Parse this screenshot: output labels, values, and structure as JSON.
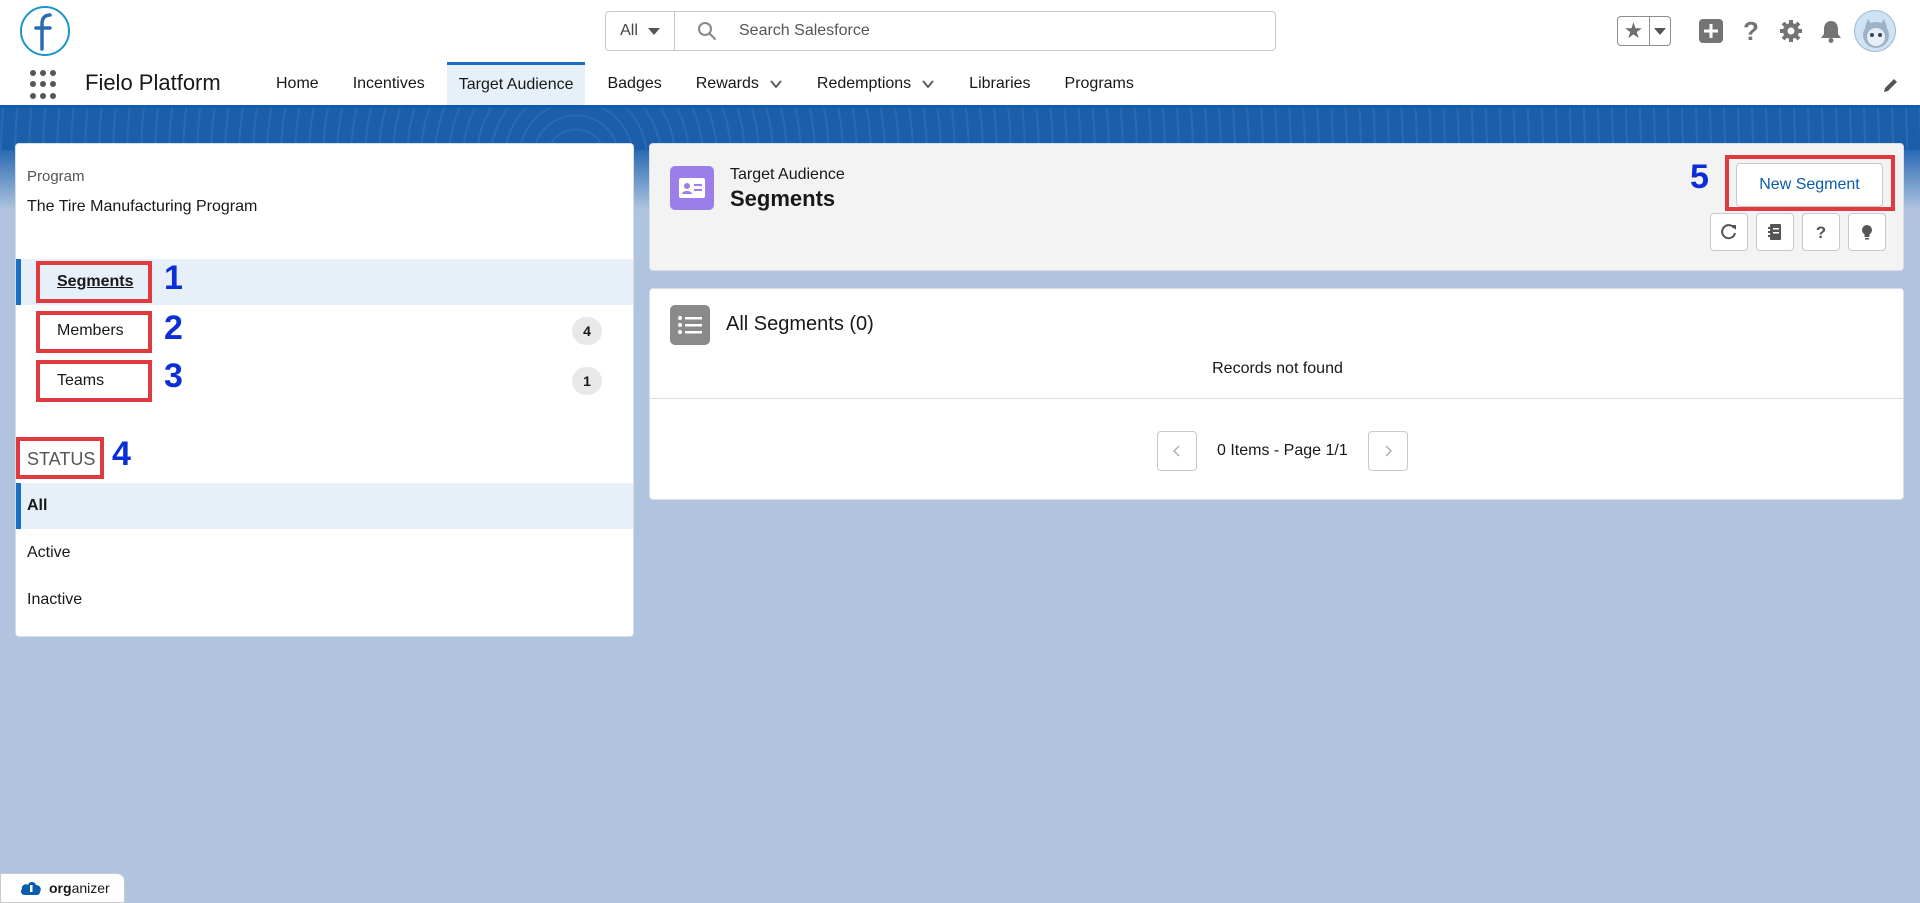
{
  "header": {
    "search_scope": "All",
    "search_placeholder": "Search Salesforce",
    "icons": [
      "logo-f-icon",
      "search-icon",
      "favorites-star-icon",
      "add-icon",
      "help-icon",
      "settings-gear-icon",
      "notifications-bell-icon",
      "avatar"
    ]
  },
  "nav": {
    "app_name": "Fielo Platform",
    "tabs": [
      {
        "label": "Home"
      },
      {
        "label": "Incentives"
      },
      {
        "label": "Target Audience",
        "active": true
      },
      {
        "label": "Badges"
      },
      {
        "label": "Rewards",
        "dropdown": true
      },
      {
        "label": "Redemptions",
        "dropdown": true
      },
      {
        "label": "Libraries"
      },
      {
        "label": "Programs"
      }
    ]
  },
  "left_panel": {
    "program_label": "Program",
    "program_name": "The Tire Manufacturing Program",
    "items": [
      {
        "label": "Segments",
        "selected": true
      },
      {
        "label": "Members",
        "count": "4"
      },
      {
        "label": "Teams",
        "count": "1"
      }
    ],
    "status_heading": "STATUS",
    "status_items": [
      {
        "label": "All",
        "selected": true
      },
      {
        "label": "Active"
      },
      {
        "label": "Inactive"
      }
    ]
  },
  "header_card": {
    "subtitle": "Target Audience",
    "title": "Segments",
    "new_button": "New Segment"
  },
  "list_card": {
    "title": "All Segments (0)",
    "empty_text": "Records not found",
    "pager_text": "0 Items - Page 1/1"
  },
  "annotations": [
    "1",
    "2",
    "3",
    "4",
    "5"
  ],
  "organizer": {
    "bold": "org",
    "rest": "anizer"
  },
  "colors": {
    "brand_blue": "#0b5cab",
    "annotation_red": "#e03a3e",
    "annotation_number": "#0b2fd6",
    "segment_icon_purple": "#9b7ee8",
    "page_background": "#b0c4df"
  }
}
